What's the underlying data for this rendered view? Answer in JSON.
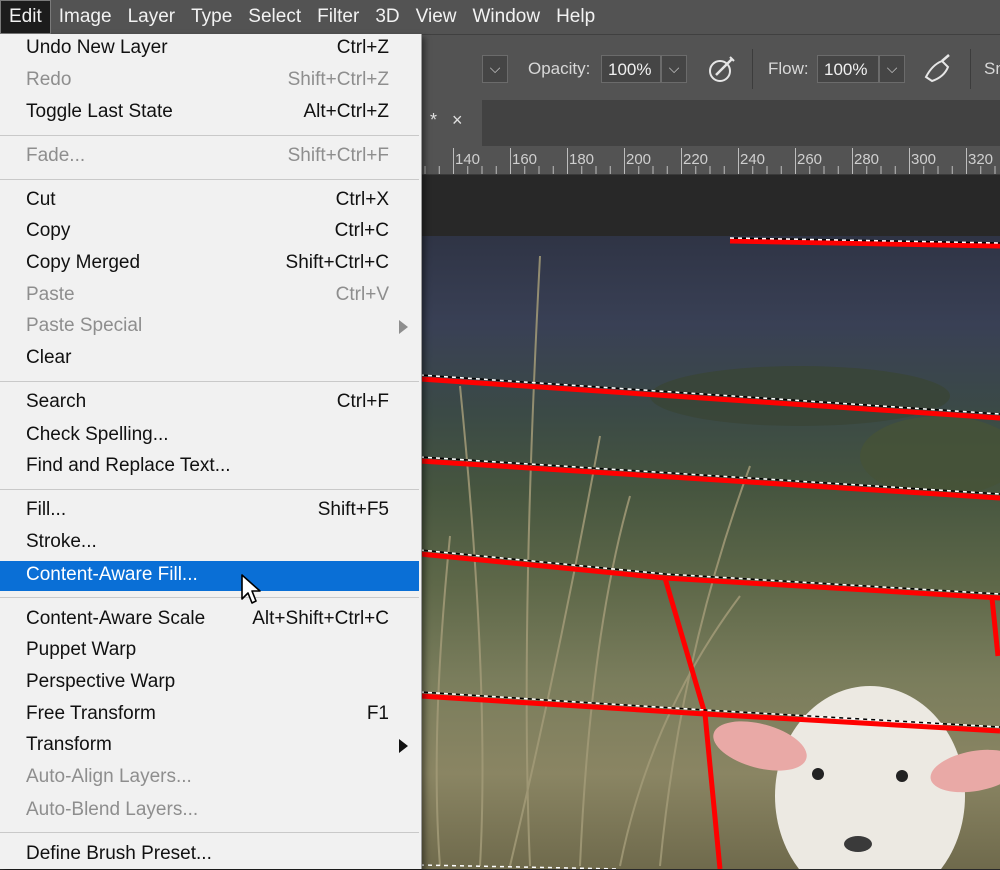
{
  "menubar": {
    "items": [
      "Edit",
      "Image",
      "Layer",
      "Type",
      "Select",
      "Filter",
      "3D",
      "View",
      "Window",
      "Help"
    ],
    "active_index": 0
  },
  "options_bar": {
    "opacity_label": "Opacity:",
    "opacity_value": "100%",
    "flow_label": "Flow:",
    "flow_value": "100%",
    "truncated_label": "Sm"
  },
  "document_tab": {
    "modified_marker": "*",
    "close_glyph": "×"
  },
  "ruler": {
    "ticks": [
      "140",
      "160",
      "180",
      "200",
      "220",
      "240",
      "260",
      "280",
      "300",
      "320"
    ]
  },
  "edit_menu": {
    "items": [
      {
        "label": "Undo New Layer",
        "shortcut": "Ctrl+Z",
        "disabled": false
      },
      {
        "label": "Redo",
        "shortcut": "Shift+Ctrl+Z",
        "disabled": true
      },
      {
        "label": "Toggle Last State",
        "shortcut": "Alt+Ctrl+Z",
        "disabled": false
      },
      {
        "label": "Fade...",
        "shortcut": "Shift+Ctrl+F",
        "disabled": true
      },
      {
        "label": "Cut",
        "shortcut": "Ctrl+X",
        "disabled": false
      },
      {
        "label": "Copy",
        "shortcut": "Ctrl+C",
        "disabled": false
      },
      {
        "label": "Copy Merged",
        "shortcut": "Shift+Ctrl+C",
        "disabled": false
      },
      {
        "label": "Paste",
        "shortcut": "Ctrl+V",
        "disabled": true
      },
      {
        "label": "Paste Special",
        "shortcut": "",
        "disabled": true,
        "submenu": true
      },
      {
        "label": "Clear",
        "shortcut": "",
        "disabled": false
      },
      {
        "label": "Search",
        "shortcut": "Ctrl+F",
        "disabled": false
      },
      {
        "label": "Check Spelling...",
        "shortcut": "",
        "disabled": false
      },
      {
        "label": "Find and Replace Text...",
        "shortcut": "",
        "disabled": false
      },
      {
        "label": "Fill...",
        "shortcut": "Shift+F5",
        "disabled": false
      },
      {
        "label": "Stroke...",
        "shortcut": "",
        "disabled": false
      },
      {
        "label": "Content-Aware Fill...",
        "shortcut": "",
        "disabled": false,
        "highlighted": true
      },
      {
        "label": "Content-Aware Scale",
        "shortcut": "Alt+Shift+Ctrl+C",
        "disabled": false
      },
      {
        "label": "Puppet Warp",
        "shortcut": "",
        "disabled": false
      },
      {
        "label": "Perspective Warp",
        "shortcut": "",
        "disabled": false
      },
      {
        "label": "Free Transform",
        "shortcut": "F1",
        "disabled": false
      },
      {
        "label": "Transform",
        "shortcut": "",
        "disabled": false,
        "submenu": true
      },
      {
        "label": "Auto-Align Layers...",
        "shortcut": "",
        "disabled": true
      },
      {
        "label": "Auto-Blend Layers...",
        "shortcut": "",
        "disabled": true
      },
      {
        "label": "Define Brush Preset...",
        "shortcut": "",
        "disabled": false
      }
    ]
  },
  "colors": {
    "highlight": "#0a6fd6",
    "selection_stroke": "#ff0000",
    "ui_panel": "#535353"
  }
}
